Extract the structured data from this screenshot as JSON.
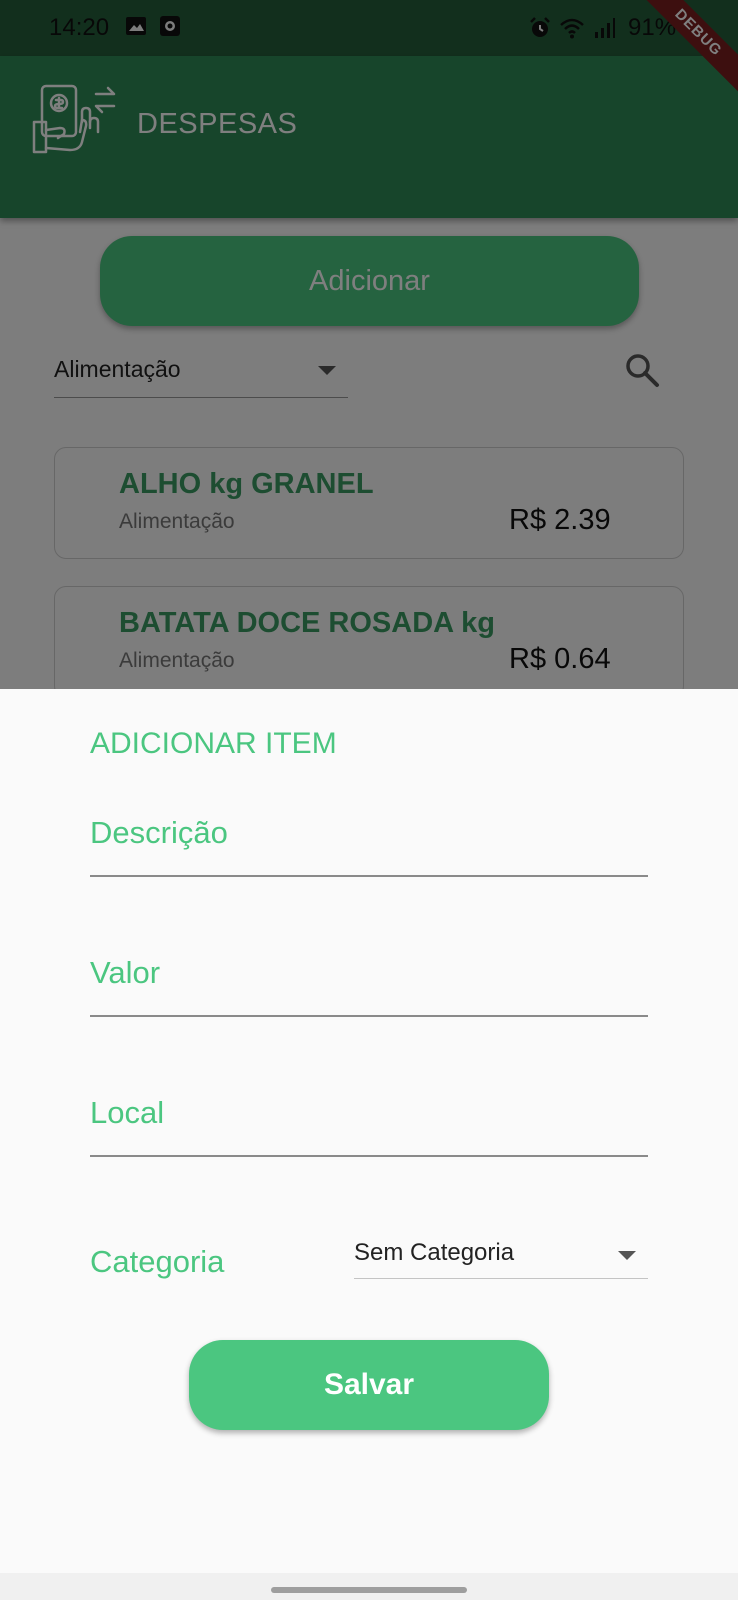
{
  "status_bar": {
    "time": "14:20",
    "battery": "91%",
    "icons_left": [
      "image-icon",
      "record-icon"
    ],
    "icons_right": [
      "alarm-icon",
      "wifi-icon",
      "signal-icon"
    ]
  },
  "debug_banner": "DEBUG",
  "app_bar": {
    "title": "DESPESAS",
    "logo": "payment-exchange-icon"
  },
  "list_screen": {
    "add_button": "Adicionar",
    "category_filter": "Alimentação",
    "search_icon": "search-icon",
    "items": [
      {
        "name": "ALHO kg GRANEL",
        "category": "Alimentação",
        "price": "R$ 2.39"
      },
      {
        "name": "BATATA DOCE ROSADA kg",
        "category": "Alimentação",
        "price": "R$ 0.64"
      }
    ]
  },
  "sheet": {
    "title": "ADICIONAR ITEM",
    "fields": {
      "description": "Descrição",
      "value": "Valor",
      "location": "Local"
    },
    "category_label": "Categoria",
    "category_value": "Sem Categoria",
    "save_button": "Salvar"
  },
  "colors": {
    "accent": "#4bc680",
    "app_bar": "#2e8b57",
    "status_bar": "#255f3b"
  }
}
